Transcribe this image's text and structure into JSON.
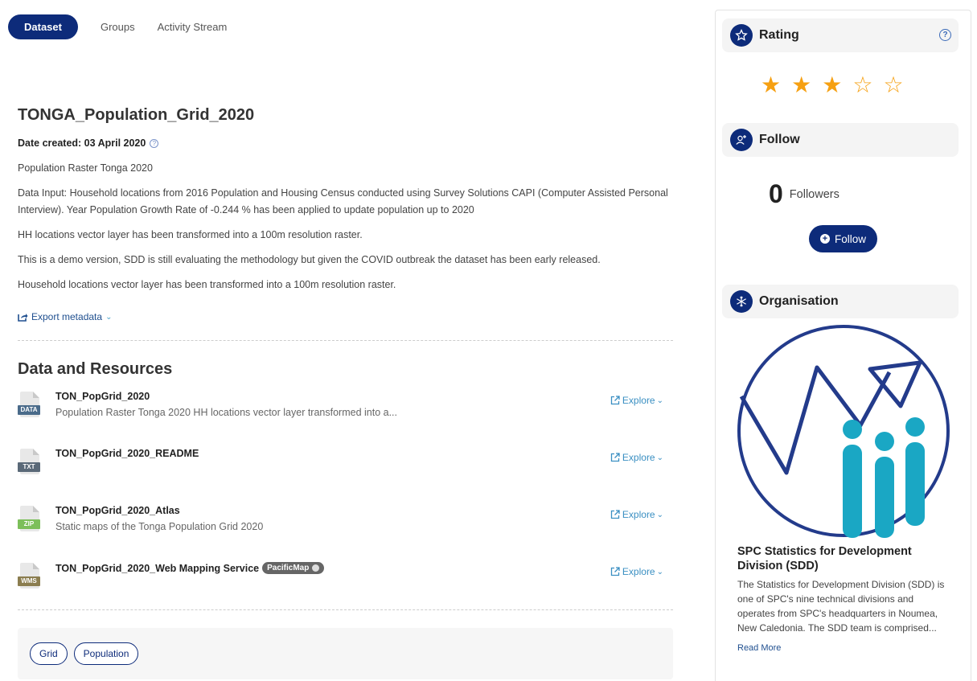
{
  "tabs": [
    {
      "label": "Dataset",
      "active": true
    },
    {
      "label": "Groups",
      "active": false
    },
    {
      "label": "Activity Stream",
      "active": false
    }
  ],
  "dataset": {
    "title": "TONGA_Population_Grid_2020",
    "date_created": "Date created: 03 April 2020",
    "paragraphs": [
      "Population Raster Tonga 2020",
      "Data Input: Household locations from 2016 Population and Housing Census conducted using Survey Solutions CAPI (Computer Assisted Personal Interview). Year Population Growth Rate of -0.244 % has been applied to update population up to 2020",
      "HH locations vector layer has been transformed into a 100m resolution raster.",
      "This is a demo version, SDD is still evaluating the methodology but given the COVID outbreak the dataset has been early released.",
      "Household locations vector layer has been transformed into a 100m resolution raster."
    ],
    "export_label": "Export metadata"
  },
  "resources": {
    "title": "Data and Resources",
    "explore_label": "Explore",
    "items": [
      {
        "name": "TON_PopGrid_2020",
        "desc": "Population Raster Tonga 2020 HH locations vector layer transformed into a...",
        "format": "DATA",
        "color": "#4a6b8a",
        "badge": ""
      },
      {
        "name": "TON_PopGrid_2020_README",
        "desc": "",
        "format": "TXT",
        "color": "#5a6978",
        "badge": ""
      },
      {
        "name": "TON_PopGrid_2020_Atlas",
        "desc": "Static maps of the Tonga Population Grid 2020",
        "format": "ZIP",
        "color": "#7cbf5a",
        "badge": ""
      },
      {
        "name": "TON_PopGrid_2020_Web Mapping Service",
        "desc": "",
        "format": "WMS",
        "color": "#8b7d4f",
        "badge": "PacificMap"
      }
    ]
  },
  "tags": [
    "Grid",
    "Population"
  ],
  "sidebar": {
    "rating": {
      "title": "Rating",
      "value": 3,
      "max": 5
    },
    "follow": {
      "title": "Follow",
      "count": "0",
      "count_label": "Followers",
      "button_label": "Follow"
    },
    "organisation": {
      "title": "Organisation",
      "name": "SPC Statistics for Development Division (SDD)",
      "description": "The Statistics for Development Division (SDD) is one of SPC's nine technical divisions and operates from SPC's headquarters in Noumea, New Caledonia. The SDD team is comprised...",
      "read_more": "Read More"
    }
  },
  "colors": {
    "primary": "#0d2b7a",
    "accent": "#3a8fc2",
    "star": "#f6a012",
    "logo_teal": "#1aa7c4"
  }
}
